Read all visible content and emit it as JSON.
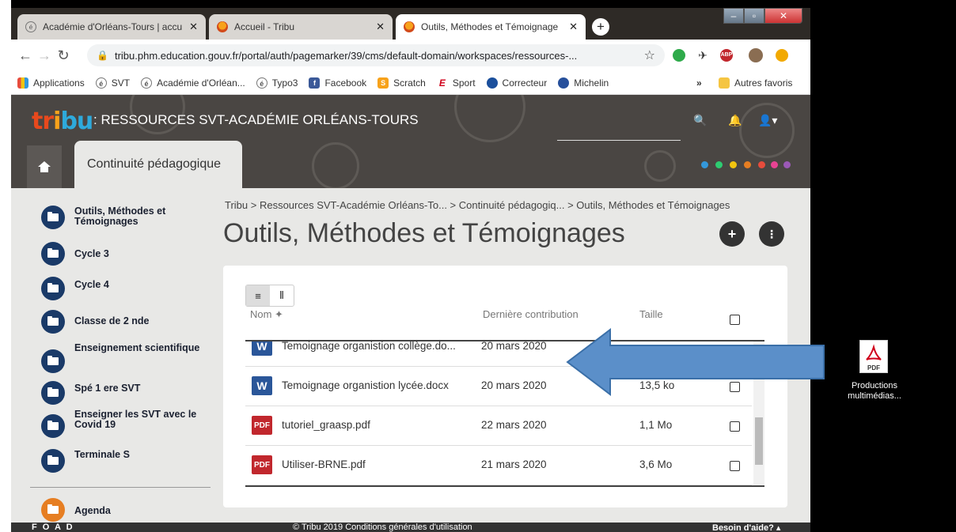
{
  "browser": {
    "tabs": [
      {
        "label": "Académie d'Orléans-Tours | accu",
        "close": "✕"
      },
      {
        "label": "Accueil - Tribu",
        "close": "✕"
      },
      {
        "label": "Outils, Méthodes et Témoignage",
        "close": "✕"
      }
    ],
    "newtab": "+",
    "url": "tribu.phm.education.gouv.fr/portal/auth/pagemarker/39/cms/default-domain/workspaces/ressources-...",
    "bookmarks": [
      "Applications",
      "SVT",
      "Académie d'Orléan...",
      "Typo3",
      "Facebook",
      "Scratch",
      "Sport",
      "Correcteur",
      "Michelin"
    ],
    "bookmarks_more": "»",
    "other_bookmarks": "Autres favoris",
    "ext_abp": "ABP"
  },
  "header": {
    "logo": "tribu",
    "site_title": ": RESSOURCES SVT-ACADÉMIE ORLÉANS-TOURS",
    "space_tab": "Continuité pédagogique",
    "dot_colors": [
      "#3498db",
      "#2ecc71",
      "#f1c40f",
      "#e67e22",
      "#e74c3c",
      "#e84393",
      "#9b59b6"
    ]
  },
  "sidebar": {
    "items": [
      "Outils, Méthodes et Témoignages",
      "Cycle 3",
      "Cycle 4",
      "Classe de 2 nde",
      "Enseignement scientifique",
      "Spé 1 ere SVT",
      "Enseigner les SVT avec le Covid 19",
      "Terminale S"
    ],
    "agenda": "Agenda"
  },
  "main": {
    "breadcrumb": "Tribu > Ressources SVT-Académie Orléans-To... > Continuité pédagogiq... > Outils, Méthodes et Témoignages",
    "title": "Outils, Méthodes et Témoignages",
    "columns": {
      "name": "Nom ✦",
      "date": "Dernière contribution",
      "size": "Taille"
    },
    "files": [
      {
        "type": "W",
        "name": "Temoignage organistion collège.do...",
        "date": "20 mars 2020",
        "size": ""
      },
      {
        "type": "W",
        "name": "Temoignage organistion lycée.docx",
        "date": "20 mars 2020",
        "size": "13,5 ko"
      },
      {
        "type": "PDF",
        "name": "tutoriel_graasp.pdf",
        "date": "22 mars 2020",
        "size": "1,1 Mo"
      },
      {
        "type": "PDF",
        "name": "Utiliser-BRNE.pdf",
        "date": "21 mars 2020",
        "size": "3,6 Mo"
      }
    ]
  },
  "footer": {
    "left": "F O A D",
    "center": "© Tribu 2019   Conditions générales d'utilisation",
    "right": "Besoin d'aide? ▴"
  },
  "desktop": {
    "pdf_label": "Productions multimédias...",
    "pdf_icon_text": "PDF"
  },
  "colors": {
    "arrow": "#5b8fc9",
    "folder": "#1a3a68"
  }
}
